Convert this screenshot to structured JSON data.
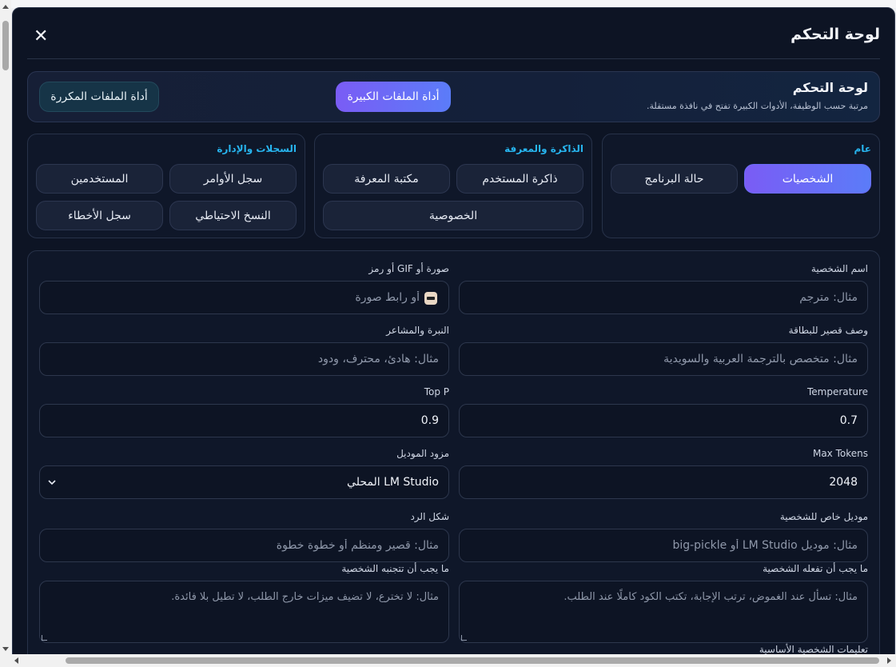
{
  "modal": {
    "title": "لوحة التحكم",
    "close_label": "✕"
  },
  "banner": {
    "title": "لوحة التحكم",
    "subtitle": "مرتبة حسب الوظيفة، الأدوات الكبيرة تفتح في نافذة مستقلة.",
    "large_files_label": "أداة الملفات الكبيرة",
    "duplicate_files_label": "أداة الملفات المكررة"
  },
  "groups": {
    "general": {
      "title": "عام",
      "items": [
        "الشخصيات",
        "حالة البرنامج"
      ],
      "active": "الشخصيات"
    },
    "memory": {
      "title": "الذاكرة والمعرفة",
      "items": [
        "ذاكرة المستخدم",
        "مكتبة المعرفة",
        "الخصوصية"
      ]
    },
    "logs": {
      "title": "السجلات والإدارة",
      "items": [
        "سجل الأوامر",
        "المستخدمين",
        "النسخ الاحتياطي",
        "سجل الأخطاء"
      ]
    }
  },
  "form": {
    "persona_name": {
      "label": "اسم الشخصية",
      "placeholder": "مثال: مترجم"
    },
    "avatar": {
      "label": "صورة أو GIF أو رمز",
      "placeholder": "أو رابط صورة"
    },
    "card_desc": {
      "label": "وصف قصير للبطاقة",
      "placeholder": "مثال: متخصص بالترجمة العربية والسويدية"
    },
    "tone": {
      "label": "النبرة والمشاعر",
      "placeholder": "مثال: هادئ، محترف، ودود"
    },
    "temperature": {
      "label": "Temperature",
      "value": "0.7"
    },
    "top_p": {
      "label": "Top P",
      "value": "0.9"
    },
    "max_tokens": {
      "label": "Max Tokens",
      "value": "2048"
    },
    "provider": {
      "label": "مزود الموديل",
      "value": "LM Studio المحلي"
    },
    "custom_model": {
      "label": "موديل خاص للشخصية",
      "placeholder": "مثال: موديل LM Studio أو big-pickle"
    },
    "reply_format": {
      "label": "شكل الرد",
      "placeholder": "مثال: قصير ومنظم أو خطوة خطوة"
    },
    "should_do": {
      "label": "ما يجب أن تفعله الشخصية",
      "placeholder": "مثال: تسأل عند الغموض، ترتب الإجابة، تكتب الكود كاملًا عند الطلب."
    },
    "should_avoid": {
      "label": "ما يجب أن تتجنبه الشخصية",
      "placeholder": "مثال: لا تخترع، لا تضيف ميزات خارج الطلب، لا تطيل بلا فائدة."
    },
    "base_instructions": {
      "label": "تعليمات الشخصية الأساسية"
    }
  }
}
